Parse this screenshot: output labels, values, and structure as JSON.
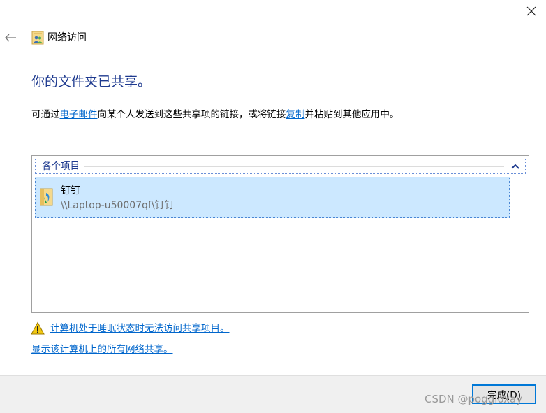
{
  "nav": {
    "title": "网络访问",
    "back_icon": "back-arrow-icon",
    "close_icon": "close-icon",
    "title_icon": "network-share-icon"
  },
  "main": {
    "heading": "你的文件夹已共享。",
    "description": {
      "part1": "可通过",
      "email_link": "电子邮件",
      "part2": "向某个人发送到这些共享项的链接，或将链接",
      "copy_link": "复制",
      "part3": "并粘贴到其他应用中。"
    }
  },
  "items_panel": {
    "group_label": "各个项目",
    "collapse_icon": "chevron-up-icon",
    "items": [
      {
        "name": "钉钉",
        "path": "\\\\Laptop-u50007qf\\钉钉",
        "icon": "shared-folder-icon"
      }
    ]
  },
  "warning": {
    "icon": "warning-icon",
    "link_text": "计算机处于睡眠状态时无法访问共享项目。"
  },
  "show_all_link": "显示该计算机上的所有网络共享。",
  "footer": {
    "finish_label": "完成(D)"
  },
  "watermark": "CSDN @poggioxay",
  "colors": {
    "heading": "#1e3a8f",
    "link": "#0066cc",
    "selection_bg": "#cce8ff",
    "accent": "#0078d7",
    "warning": "#f2c811"
  }
}
